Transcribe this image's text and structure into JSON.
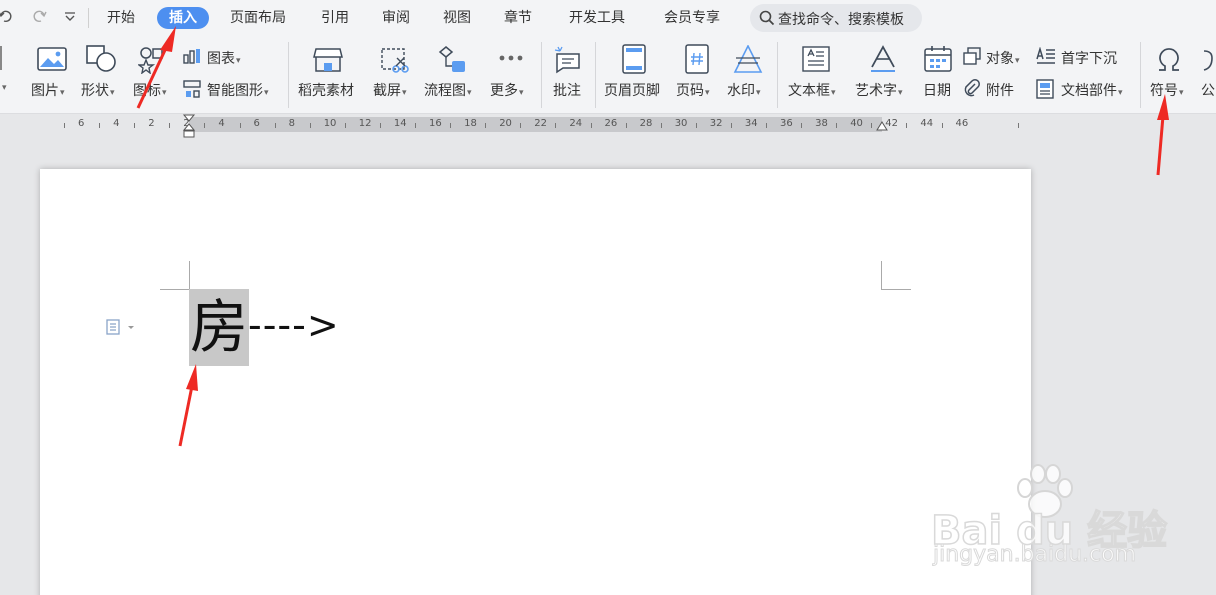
{
  "quick_access": {
    "undo_icon": "undo-icon",
    "redo_icon": "redo-icon",
    "dropdown_icon": "chevron-down-icon"
  },
  "menu": {
    "tabs": [
      {
        "label": "开始"
      },
      {
        "label": "插入"
      },
      {
        "label": "页面布局"
      },
      {
        "label": "引用"
      },
      {
        "label": "审阅"
      },
      {
        "label": "视图"
      },
      {
        "label": "章节"
      },
      {
        "label": "开发工具"
      },
      {
        "label": "会员专享"
      }
    ],
    "active_tab": "插入",
    "search_placeholder": "查找命令、搜索模板"
  },
  "ribbon": {
    "picture": "图片",
    "shape": "形状",
    "icon": "图标",
    "chart": "图表",
    "smart_art": "智能图形",
    "daoke": "稻壳素材",
    "screenshot": "截屏",
    "flowchart": "流程图",
    "more": "更多",
    "comment": "批注",
    "header_footer": "页眉页脚",
    "page_number": "页码",
    "watermark": "水印",
    "textbox": "文本框",
    "wordart": "艺术字",
    "date": "日期",
    "object": "对象",
    "attachment": "附件",
    "drop_cap": "首字下沉",
    "doc_parts": "文档部件",
    "symbol": "符号",
    "formula": "公"
  },
  "ruler": {
    "ticks": [
      "6",
      "4",
      "2",
      "2",
      "4",
      "6",
      "8",
      "10",
      "12",
      "14",
      "16",
      "18",
      "20",
      "22",
      "24",
      "26",
      "28",
      "30",
      "32",
      "34",
      "36",
      "38",
      "40",
      "42",
      "44",
      "46"
    ]
  },
  "document": {
    "selected_char": "房",
    "arrow_text": "---->"
  },
  "watermark": {
    "brand": "Bai du 经验",
    "url": "jingyan.baidu.com"
  },
  "colors": {
    "accent": "#4d8ff0",
    "annotation": "#ee2a24",
    "selection": "#c8c8c8"
  }
}
